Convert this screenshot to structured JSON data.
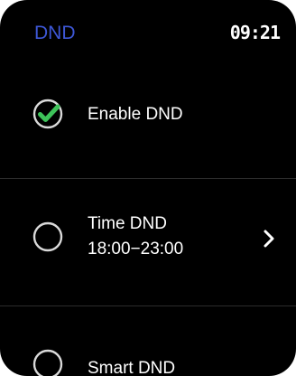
{
  "status_bar": {
    "title": "DND",
    "time": "09:21"
  },
  "options": [
    {
      "label": "Enable DND",
      "checked": true
    },
    {
      "label": "Time DND",
      "sublabel": "18:00−23:00",
      "checked": false,
      "has_chevron": true
    },
    {
      "label": "Smart DND",
      "checked": false
    }
  ],
  "icons": {
    "checked": "check-circle-icon",
    "unchecked": "empty-circle-icon",
    "chevron": "chevron-right-icon"
  },
  "colors": {
    "background": "#000000",
    "title": "#3d57d6",
    "check": "#3ec35a",
    "circle": "#d9d9d9",
    "divider": "#2c2c2c"
  }
}
